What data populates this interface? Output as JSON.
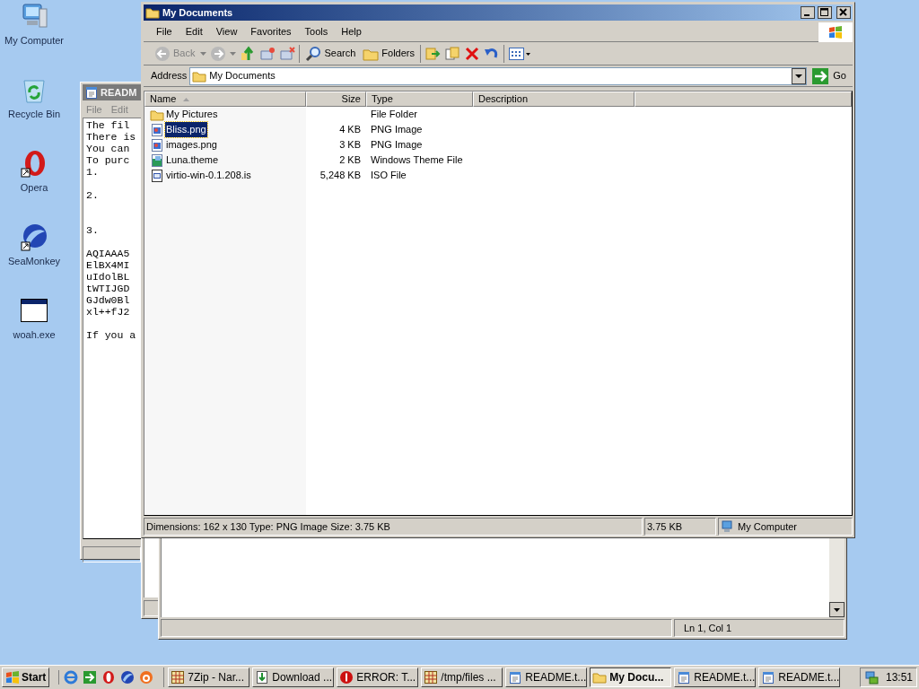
{
  "desktop_icons": [
    {
      "label": "My Computer",
      "kind": "computer"
    },
    {
      "label": "Recycle Bin",
      "kind": "recycle"
    },
    {
      "label": "Opera",
      "kind": "opera"
    },
    {
      "label": "SeaMonkey",
      "kind": "seamonkey"
    },
    {
      "label": "woah.exe",
      "kind": "app"
    }
  ],
  "readme_window": {
    "title": "READM",
    "menu": [
      "File",
      "Edit"
    ],
    "text": "The fil\nThere is\nYou can\nTo purc\n1.\n\n2.\n\n\n3.\n\nAQIAAA5\nElBX4MI\nuIdolBL\ntWTIJGD\nGJdw0Bl\nxl++fJ2\n\nIf you a"
  },
  "notepad_window": {
    "status": "Ln 1, Col 1"
  },
  "explorer": {
    "title": "My Documents",
    "menu": [
      "File",
      "Edit",
      "View",
      "Favorites",
      "Tools",
      "Help"
    ],
    "toolbar": {
      "back": "Back",
      "search": "Search",
      "folders": "Folders"
    },
    "address": {
      "label": "Address",
      "value": "My Documents",
      "go": "Go"
    },
    "columns": [
      "Name",
      "Size",
      "Type",
      "Description"
    ],
    "rows": [
      {
        "name": "My Pictures",
        "size": "",
        "type": "File Folder",
        "kind": "folder",
        "selected": false
      },
      {
        "name": "Bliss.png",
        "size": "4 KB",
        "type": "PNG Image",
        "kind": "image",
        "selected": true
      },
      {
        "name": "images.png",
        "size": "3 KB",
        "type": "PNG Image",
        "kind": "image",
        "selected": false
      },
      {
        "name": "Luna.theme",
        "size": "2 KB",
        "type": "Windows Theme File",
        "kind": "theme",
        "selected": false
      },
      {
        "name": "virtio-win-0.1.208.is",
        "size": "5,248 KB",
        "type": "ISO File",
        "kind": "iso",
        "selected": false
      }
    ],
    "status": {
      "text": "Dimensions: 162 x 130 Type: PNG Image Size: 3.75 KB",
      "size": "3.75 KB",
      "zone": "My Computer"
    }
  },
  "taskbar": {
    "start": "Start",
    "quick_launch": [
      {
        "kind": "ie"
      },
      {
        "kind": "arrow"
      },
      {
        "kind": "opera"
      },
      {
        "kind": "seamonkey"
      },
      {
        "kind": "orange"
      }
    ],
    "tasks": [
      {
        "label": "7Zip - Nar...",
        "kind": "grid",
        "selected": false
      },
      {
        "label": "Download ...",
        "kind": "download",
        "selected": false
      },
      {
        "label": "ERROR: T...",
        "kind": "error",
        "selected": false
      },
      {
        "label": "/tmp/files ...",
        "kind": "grid",
        "selected": false
      },
      {
        "label": "README.t...",
        "kind": "notepad",
        "selected": false
      },
      {
        "label": "My Docu...",
        "kind": "folder",
        "selected": true
      },
      {
        "label": "README.t...",
        "kind": "notepad",
        "selected": false
      },
      {
        "label": "README.t...",
        "kind": "notepad",
        "selected": false
      }
    ],
    "clock": "13:51"
  }
}
